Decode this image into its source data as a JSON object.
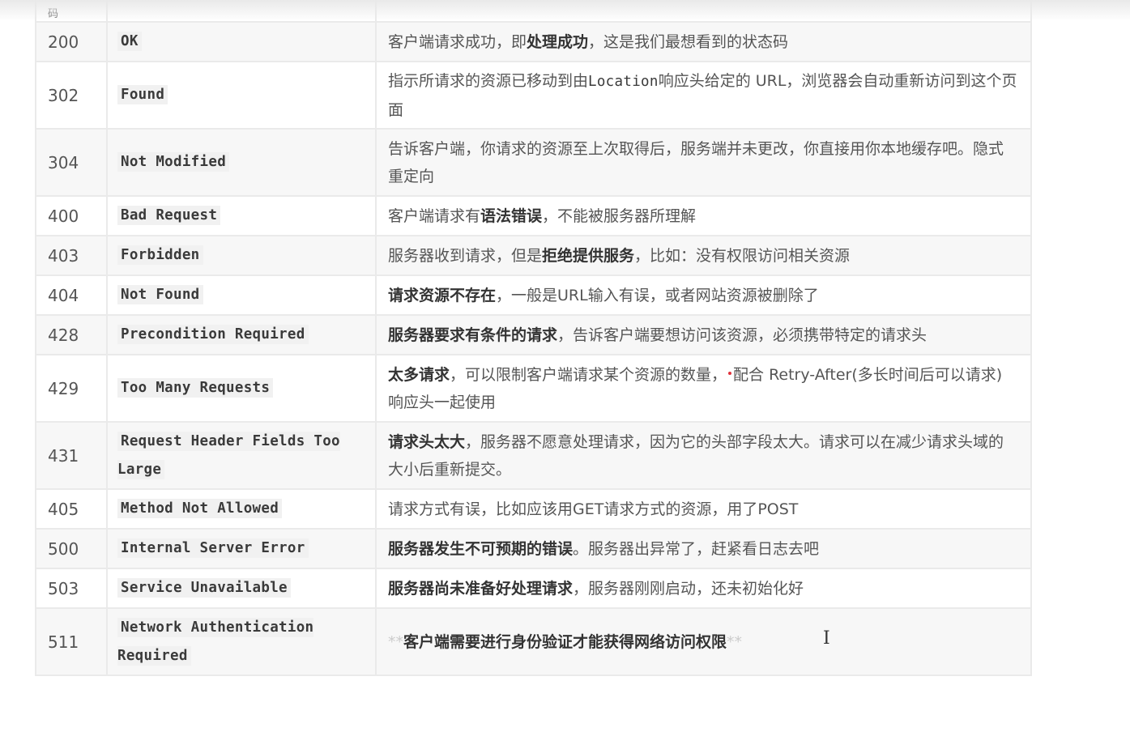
{
  "header": {
    "first_col_fragment": "码"
  },
  "rows": [
    {
      "code": "200",
      "phrase": "OK",
      "desc": [
        {
          "t": "客户端请求成功，即"
        },
        {
          "t": "处理成功",
          "b": true
        },
        {
          "t": "，这是我们最想看到的状态码"
        }
      ]
    },
    {
      "code": "302",
      "phrase": "Found",
      "desc": [
        {
          "t": "指示所请求的资源已移动到由"
        },
        {
          "t": "Location",
          "m": true
        },
        {
          "t": "响应头给定的 URL，浏览器会自动重新访问到这个页面"
        }
      ]
    },
    {
      "code": "304",
      "phrase": "Not Modified",
      "desc": [
        {
          "t": "告诉客户端，你请求的资源至上次取得后，服务端并未更改，你直接用你本地缓存吧。隐式重定向"
        }
      ]
    },
    {
      "code": "400",
      "phrase": "Bad Request",
      "desc": [
        {
          "t": "客户端请求有"
        },
        {
          "t": "语法错误",
          "b": true
        },
        {
          "t": "，不能被服务器所理解"
        }
      ]
    },
    {
      "code": "403",
      "phrase": "Forbidden",
      "desc": [
        {
          "t": "服务器收到请求，但是"
        },
        {
          "t": "拒绝提供服务",
          "b": true
        },
        {
          "t": "，比如：没有权限访问相关资源"
        }
      ]
    },
    {
      "code": "404",
      "phrase": "Not Found",
      "desc": [
        {
          "t": "请求资源不存在",
          "b": true
        },
        {
          "t": "，一般是URL输入有误，或者网站资源被删除了"
        }
      ]
    },
    {
      "code": "428",
      "phrase": "Precondition Required",
      "desc": [
        {
          "t": "服务器要求有条件的请求",
          "b": true
        },
        {
          "t": "，告诉客户端要想访问该资源，必须携带特定的请求头"
        }
      ]
    },
    {
      "code": "429",
      "phrase": "Too Many Requests",
      "desc": [
        {
          "t": "太多请求",
          "b": true
        },
        {
          "t": "，可以限制客户端请求某个资源的数量，"
        },
        {
          "dot": true
        },
        {
          "t": "配合 Retry-After(多长时间后可以请求)响应头一起使用"
        }
      ]
    },
    {
      "code": "431",
      "phrase": "Request Header Fields Too Large",
      "desc": [
        {
          "t": "请求头太大",
          "b": true
        },
        {
          "t": "，服务器不愿意处理请求，因为它的头部字段太大。请求可以在减少请求头域的大小后重新提交。"
        }
      ]
    },
    {
      "code": "405",
      "phrase": "Method Not Allowed",
      "desc": [
        {
          "t": "请求方式有误，比如应该用GET请求方式的资源，用了POST"
        }
      ]
    },
    {
      "code": "500",
      "phrase": "Internal Server Error",
      "desc": [
        {
          "t": "服务器发生不可预期的错误",
          "b": true
        },
        {
          "t": "。服务器出异常了，赶紧看日志去吧"
        }
      ]
    },
    {
      "code": "503",
      "phrase": "Service Unavailable",
      "desc": [
        {
          "t": "服务器尚未准备好处理请求",
          "b": true
        },
        {
          "t": "，服务器刚刚启动，还未初始化好"
        }
      ]
    },
    {
      "code": "511",
      "phrase": "Network Authentication Required",
      "desc": [
        {
          "t": "**",
          "k": true
        },
        {
          "t": "客户端需要进行身份验证才能获得网络访问权限",
          "b": true
        },
        {
          "t": "**",
          "k": true
        }
      ]
    }
  ],
  "colors": {
    "border": "#eaeaea",
    "row_alt": "#f7f7f7",
    "code_bg": "#f1f1f1"
  },
  "icons": {
    "text_cursor": "I-beam-cursor-icon"
  }
}
